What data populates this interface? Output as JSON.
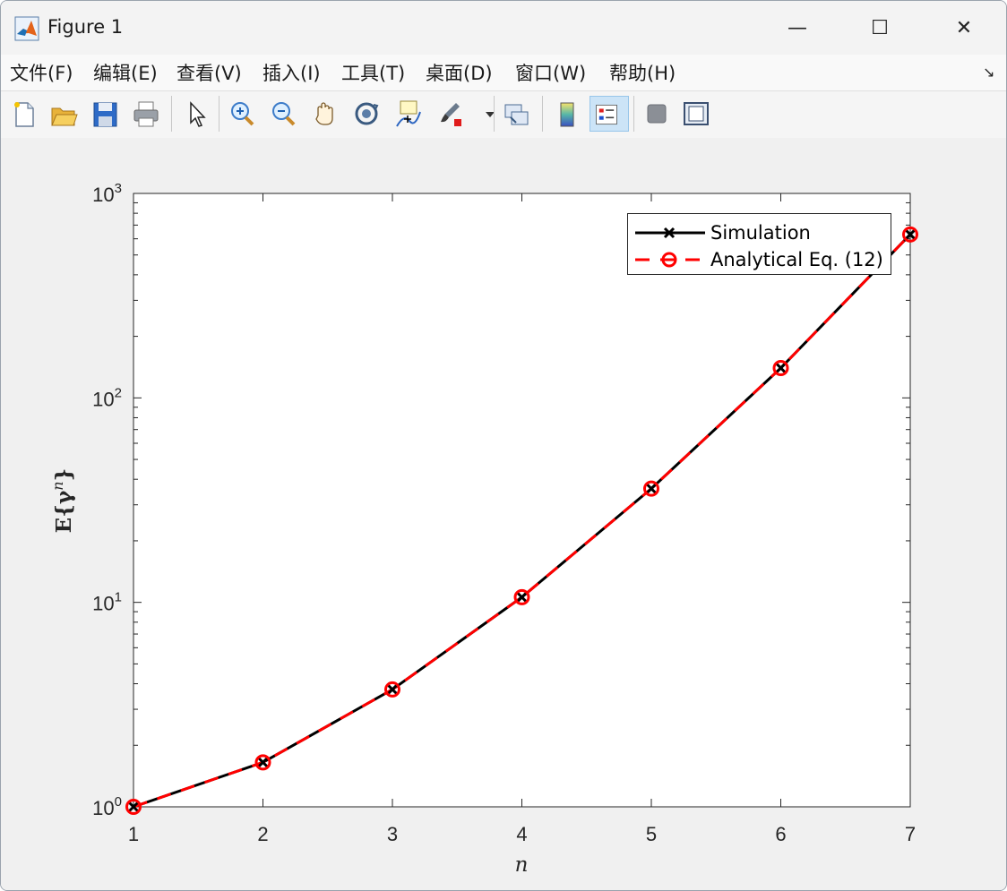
{
  "window": {
    "title": "Figure 1",
    "minimize_glyph": "—",
    "maximize_glyph": "☐",
    "close_glyph": "✕"
  },
  "menu": {
    "items": [
      "文件(F)",
      "编辑(E)",
      "查看(V)",
      "插入(I)",
      "工具(T)",
      "桌面(D)",
      "窗口(W)",
      "帮助(H)"
    ],
    "expand_glyph": "↘"
  },
  "toolbar": {
    "icons": [
      "new-figure-icon",
      "open-file-icon",
      "save-icon",
      "print-icon",
      "select-arrow-icon",
      "zoom-in-icon",
      "zoom-out-icon",
      "pan-hand-icon",
      "rotate-3d-icon",
      "data-cursor-icon",
      "brush-icon",
      "link-plot-icon",
      "colorbar-icon",
      "legend-icon",
      "hide-tools-icon",
      "show-tools-icon"
    ],
    "active": "legend-icon"
  },
  "chart_data": {
    "type": "line",
    "xlabel": "n",
    "ylabel": "E{γⁿ}",
    "ylabel_main": "E{γ",
    "ylabel_sup": "n",
    "ylabel_end": "}",
    "xlim": [
      1,
      7
    ],
    "ylim": [
      1,
      1000
    ],
    "yscale": "log",
    "x_ticks": [
      "1",
      "2",
      "3",
      "4",
      "5",
      "6",
      "7"
    ],
    "y_ticks": [
      {
        "base": "10",
        "exp": "0"
      },
      {
        "base": "10",
        "exp": "1"
      },
      {
        "base": "10",
        "exp": "2"
      },
      {
        "base": "10",
        "exp": "3"
      }
    ],
    "x": [
      1,
      2,
      3,
      4,
      5,
      6,
      7
    ],
    "series": [
      {
        "name": "Simulation",
        "values": [
          1.0,
          1.65,
          3.75,
          10.6,
          36.0,
          140,
          630
        ],
        "color": "#000000",
        "style": "solid",
        "marker": "x"
      },
      {
        "name": "Analytical Eq. (12)",
        "values": [
          1.0,
          1.65,
          3.75,
          10.6,
          36.0,
          140,
          630
        ],
        "color": "#ff0000",
        "style": "dashed",
        "marker": "circle"
      }
    ],
    "legend_position": "top-right",
    "grid": false
  }
}
